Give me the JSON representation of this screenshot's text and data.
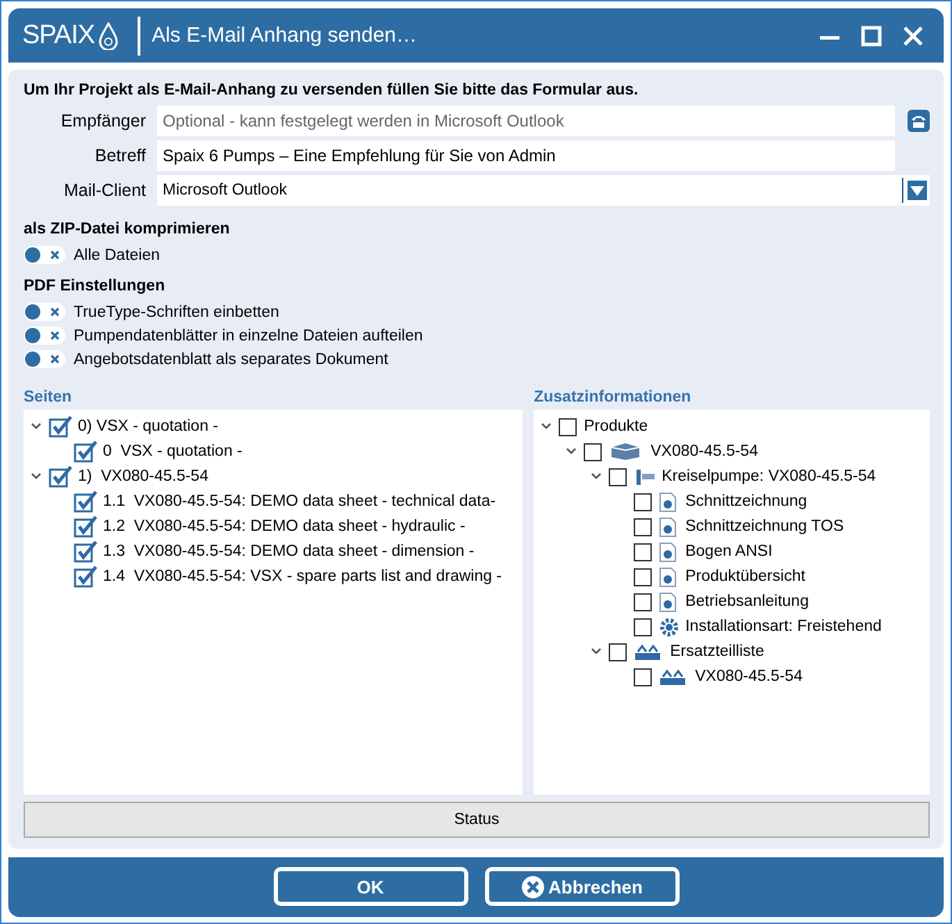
{
  "window": {
    "logo": "SPAIX",
    "title": "Als E-Mail Anhang senden…"
  },
  "intro": "Um Ihr Projekt als E-Mail-Anhang zu versenden füllen Sie bitte das Formular aus.",
  "fields": [
    {
      "label": "Empfänger",
      "kind": "text",
      "placeholder": "Optional - kann festgelegt werden in Microsoft Outlook",
      "contacts_button": true
    },
    {
      "label": "Betreff",
      "kind": "text",
      "value": "Spaix 6 Pumps – Eine Empfehlung für Sie von Admin"
    },
    {
      "label": "Mail-Client",
      "kind": "dropdown",
      "value": "Microsoft Outlook"
    }
  ],
  "sections": [
    {
      "title": "als ZIP-Datei komprimieren",
      "toggles": [
        {
          "label": "Alle Dateien",
          "on": false
        }
      ]
    },
    {
      "title": "PDF Einstellungen",
      "toggles": [
        {
          "label": "TrueType-Schriften einbetten",
          "on": false
        },
        {
          "label": "Pumpendatenblätter in einzelne Dateien aufteilen",
          "on": false
        },
        {
          "label": "Angebotsdatenblatt als separates Dokument",
          "on": false
        }
      ]
    }
  ],
  "seiten": {
    "title": "Seiten",
    "items": [
      {
        "label": "0) VSX - quotation -",
        "checked": true,
        "expanded": true,
        "children": [
          {
            "label": "0  VSX - quotation -",
            "checked": true
          }
        ]
      },
      {
        "label": "1)  VX080-45.5-54",
        "checked": true,
        "expanded": true,
        "children": [
          {
            "label": "1.1  VX080-45.5-54: DEMO data sheet - technical data-",
            "checked": true
          },
          {
            "label": "1.2  VX080-45.5-54: DEMO data sheet - hydraulic -",
            "checked": true
          },
          {
            "label": "1.3  VX080-45.5-54: DEMO data sheet - dimension -",
            "checked": true
          },
          {
            "label": "1.4  VX080-45.5-54: VSX - spare parts list and drawing -",
            "checked": true
          }
        ]
      }
    ]
  },
  "zusatz": {
    "title": "Zusatzinformationen",
    "items": [
      {
        "label": "Produkte",
        "checked": false,
        "expanded": true,
        "children": [
          {
            "label": "VX080-45.5-54",
            "checked": false,
            "expanded": true,
            "kind": "product",
            "children": [
              {
                "label": "Kreiselpumpe: VX080-45.5-54",
                "checked": false,
                "expanded": true,
                "kind": "pump",
                "children": [
                  {
                    "label": "Schnittzeichnung",
                    "checked": false,
                    "kind": "document"
                  },
                  {
                    "label": "Schnittzeichnung TOS",
                    "checked": false,
                    "kind": "document"
                  },
                  {
                    "label": "Bogen ANSI",
                    "checked": false,
                    "kind": "document"
                  },
                  {
                    "label": "Produktübersicht",
                    "checked": false,
                    "kind": "document"
                  },
                  {
                    "label": "Betriebsanleitung",
                    "checked": false,
                    "kind": "document"
                  },
                  {
                    "label": "Installationsart: Freistehend",
                    "checked": false,
                    "kind": "gear"
                  }
                ]
              },
              {
                "label": "Ersatzteilliste",
                "checked": false,
                "expanded": true,
                "kind": "parts",
                "children": [
                  {
                    "label": "VX080-45.5-54",
                    "checked": false,
                    "kind": "parts"
                  }
                ]
              }
            ]
          }
        ]
      }
    ]
  },
  "status": "Status",
  "buttons": [
    {
      "label": "OK",
      "kind": "ok"
    },
    {
      "label": "Abbrechen",
      "kind": "cancel"
    }
  ]
}
